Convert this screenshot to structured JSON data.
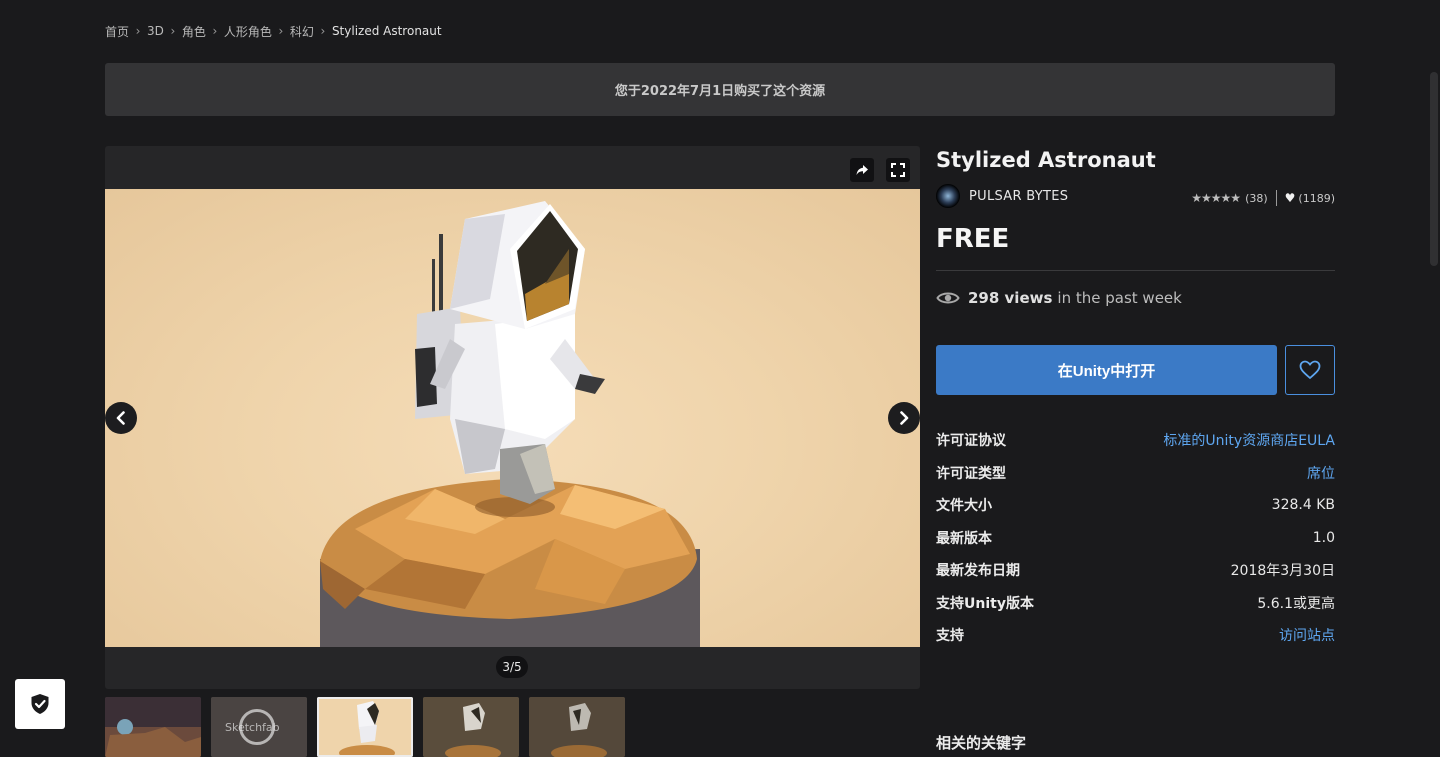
{
  "breadcrumb": [
    {
      "label": "首页"
    },
    {
      "label": "3D"
    },
    {
      "label": "角色"
    },
    {
      "label": "人形角色"
    },
    {
      "label": "科幻"
    },
    {
      "label": "Stylized Astronaut"
    }
  ],
  "banner": {
    "text": "您于2022年7月1日购买了这个资源"
  },
  "viewer": {
    "counter": "3/5",
    "icons": [
      "share-icon",
      "fullscreen-icon",
      "chevron-left-icon",
      "chevron-right-icon"
    ],
    "thumbnails": [
      {
        "kind": "image"
      },
      {
        "kind": "video",
        "label": "Sketchfab"
      },
      {
        "kind": "image",
        "selected": true
      },
      {
        "kind": "image"
      },
      {
        "kind": "image"
      }
    ]
  },
  "asset": {
    "title": "Stylized Astronaut",
    "publisher": "PULSAR BYTES",
    "rating_stars": 5,
    "rating_count": "(38)",
    "favorites": "(1189)",
    "price": "FREE",
    "views_count": "298 views",
    "views_suffix": "in the past week",
    "open_button": "在Unity中打开"
  },
  "info": [
    {
      "key": "许可证协议",
      "value": "标准的Unity资源商店EULA",
      "link": true
    },
    {
      "key": "许可证类型",
      "value": "席位",
      "link": true
    },
    {
      "key": "文件大小",
      "value": "328.4 KB",
      "link": false
    },
    {
      "key": "最新版本",
      "value": "1.0",
      "link": false
    },
    {
      "key": "最新发布日期",
      "value": "2018年3月30日",
      "link": false
    },
    {
      "key": "支持Unity版本",
      "value": "5.6.1或更高",
      "link": false
    },
    {
      "key": "支持",
      "value": "访问站点",
      "link": true
    }
  ],
  "keywords_title": "相关的关键字",
  "colors": {
    "accent": "#3b7ac6",
    "link": "#5ea6f0",
    "background": "#1a1a1c"
  }
}
